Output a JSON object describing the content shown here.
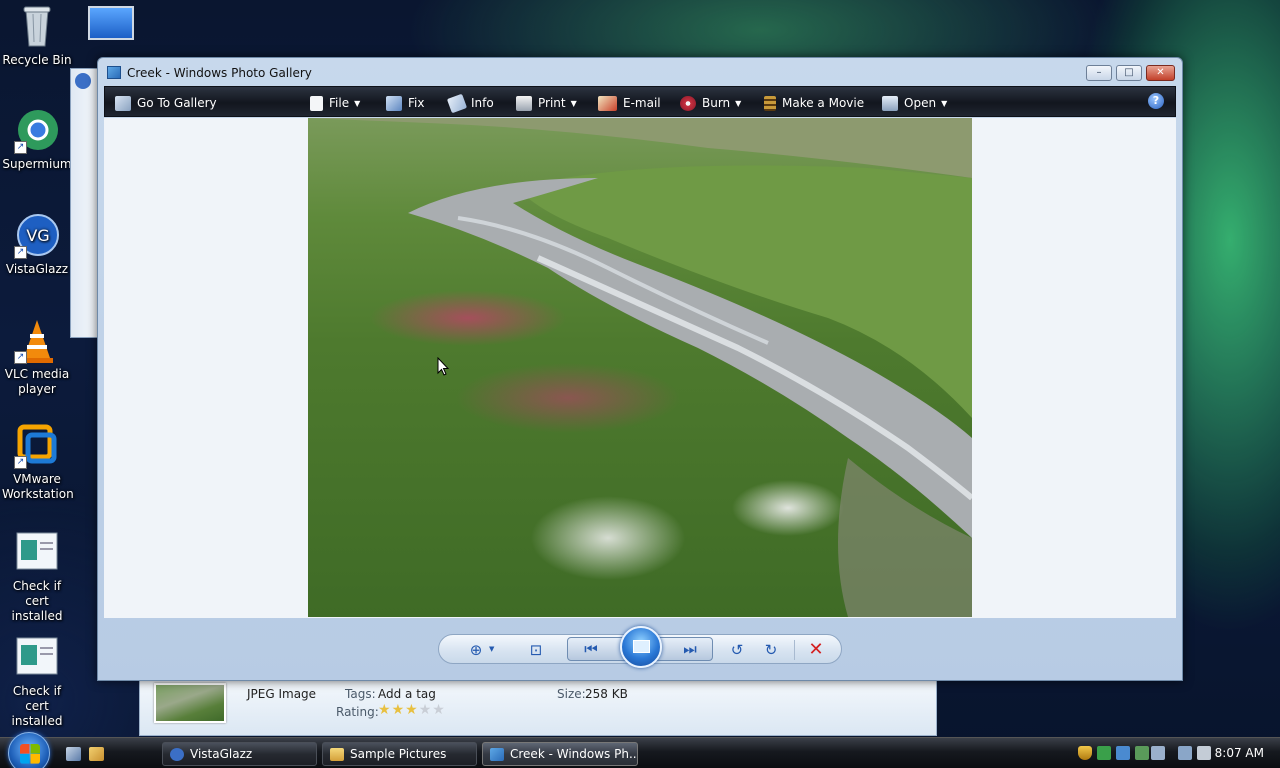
{
  "desktop": {
    "icons": [
      {
        "label": "Recycle Bin"
      },
      {
        "label": "Supermium"
      },
      {
        "label": "VistaGlazz"
      },
      {
        "label": "VLC media player"
      },
      {
        "label": "VMware Workstation"
      },
      {
        "label": "Check if cert installed"
      },
      {
        "label": "Check if cert installed"
      }
    ]
  },
  "window": {
    "title": "Creek - Windows Photo Gallery",
    "controls": {
      "minimize": "–",
      "maximize": "□",
      "close": "✕"
    }
  },
  "toolbar": {
    "go_to_gallery": "Go To Gallery",
    "file": "File",
    "fix": "Fix",
    "info": "Info",
    "print": "Print",
    "email": "E-mail",
    "burn": "Burn",
    "make_movie": "Make a Movie",
    "open": "Open",
    "help": "?"
  },
  "controls_bar": {
    "zoom": "⊕",
    "fit": "⊡",
    "previous": "⏮",
    "next": "⏭",
    "rotate_ccw": "↺",
    "rotate_cw": "↻",
    "delete": "✕"
  },
  "details": {
    "file_type": "JPEG Image",
    "tags_label": "Tags:",
    "tags_value": "Add a tag",
    "rating_label": "Rating:",
    "rating": 3,
    "rating_max": 5,
    "size_label": "Size:",
    "size_value": "258 KB"
  },
  "taskbar": {
    "buttons": [
      {
        "label": "VistaGlazz"
      },
      {
        "label": "Sample Pictures"
      },
      {
        "label": "Creek - Windows Ph..."
      }
    ],
    "clock": "8:07 AM"
  },
  "colors": {
    "accent": "#245ab0",
    "toolbar_bg": "#12161e",
    "delete": "#d42020"
  }
}
